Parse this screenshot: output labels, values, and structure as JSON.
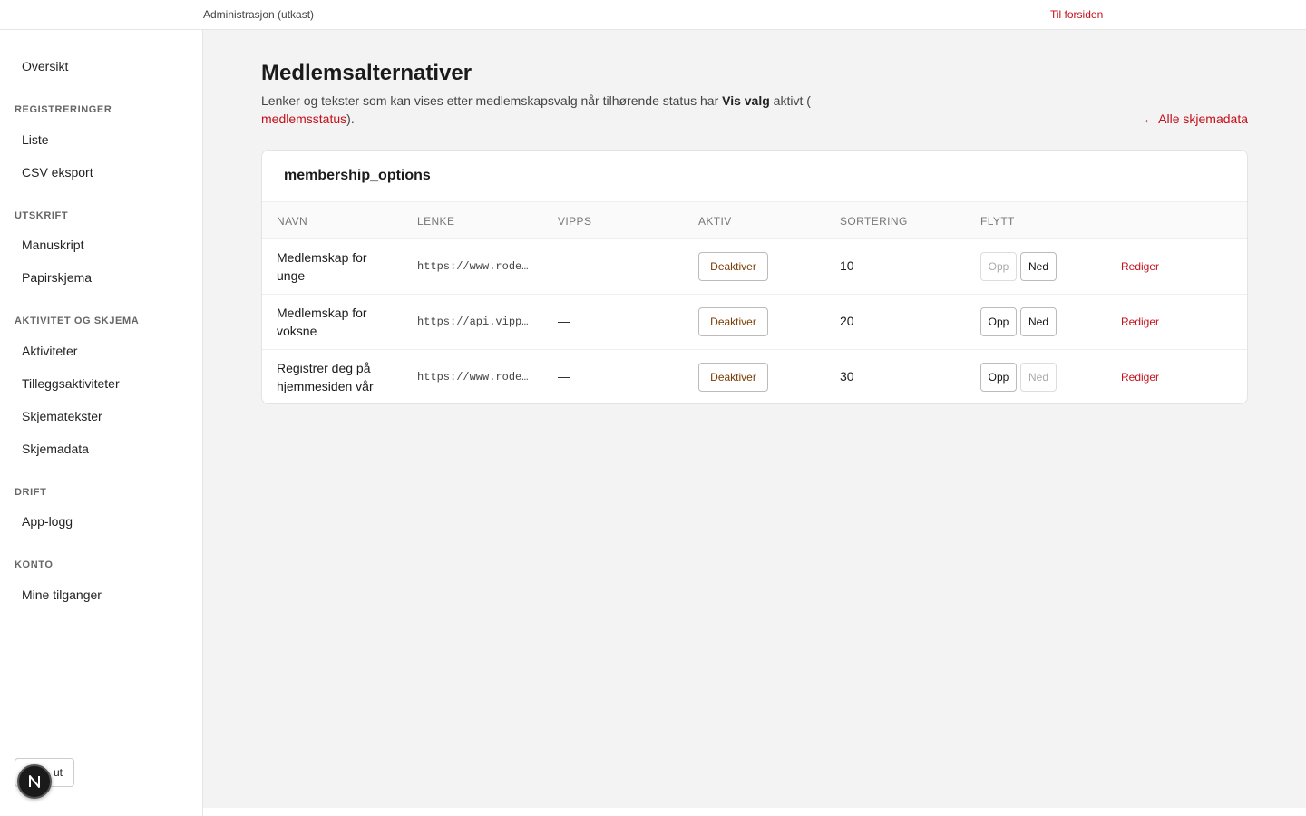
{
  "topbar": {
    "app_title": "Administrasjon (utkast)",
    "home_link": "Til forsiden"
  },
  "sidebar": {
    "overview": "Oversikt",
    "sections": [
      {
        "title": "REGISTRERINGER",
        "items": [
          "Liste",
          "CSV eksport"
        ]
      },
      {
        "title": "UTSKRIFT",
        "items": [
          "Manuskript",
          "Papirskjema"
        ]
      },
      {
        "title": "AKTIVITET OG SKJEMA",
        "items": [
          "Aktiviteter",
          "Tilleggsaktiviteter",
          "Skjematekster",
          "Skjemadata"
        ]
      },
      {
        "title": "DRIFT",
        "items": [
          "App-logg"
        ]
      },
      {
        "title": "KONTO",
        "items": [
          "Mine tilganger"
        ]
      }
    ],
    "logout_label": "ut",
    "badge_letter": "N"
  },
  "page": {
    "title": "Medlemsalternativer",
    "desc_prefix": "Lenker og tekster som kan vises etter medlemskapsvalg når tilhørende status har ",
    "desc_bold": "Vis valg",
    "desc_mid": " aktivt (",
    "desc_link": "medlemsstatus",
    "desc_suffix": ").",
    "back_link": "← Alle skjemadata"
  },
  "card": {
    "title": "membership_options",
    "columns": [
      "NAVN",
      "LENKE",
      "VIPPS",
      "AKTIV",
      "SORTERING",
      "FLYTT"
    ],
    "rows": [
      {
        "name": "Medlemskap for unge",
        "link": "https://www.rodeungdom.no/medlem",
        "vipps": "—",
        "active_label": "Deaktiver",
        "sort": "10",
        "up": "Opp",
        "down": "Ned",
        "up_disabled": true,
        "down_disabled": false,
        "edit": "Rediger"
      },
      {
        "name": "Medlemskap for voksne",
        "link": "https://api.vipps.no/dwo-api-application",
        "vipps": "—",
        "active_label": "Deaktiver",
        "sort": "20",
        "up": "Opp",
        "down": "Ned",
        "up_disabled": false,
        "down_disabled": false,
        "edit": "Rediger"
      },
      {
        "name": "Registrer deg på hjemmesiden vår",
        "link": "https://www.rodeungdom.no/registrer",
        "vipps": "—",
        "active_label": "Deaktiver",
        "sort": "30",
        "up": "Opp",
        "down": "Ned",
        "up_disabled": false,
        "down_disabled": true,
        "edit": "Rediger"
      }
    ]
  },
  "colors": {
    "accent": "#c4101b",
    "deactivate_text": "#7a3a00",
    "background": "#f3f3f3"
  }
}
